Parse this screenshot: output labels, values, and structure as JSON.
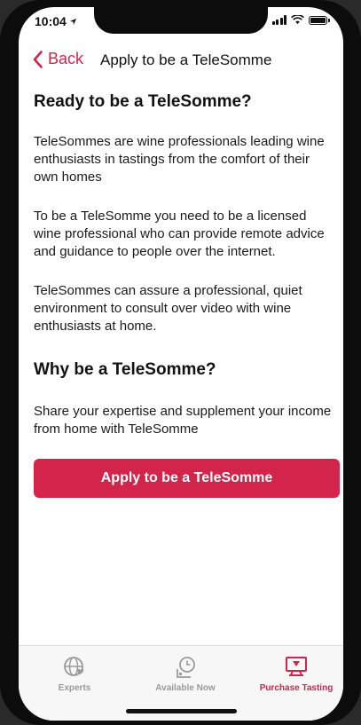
{
  "status": {
    "time": "10:04"
  },
  "nav": {
    "back_label": "Back",
    "title": "Apply to be a TeleSomme"
  },
  "content": {
    "heading1": "Ready to be a TeleSomme?",
    "para1": "TeleSommes are wine professionals leading wine enthusiasts in tastings from the comfort of their own homes",
    "para2": "To be a TeleSomme you need to be a licensed wine professional who can provide remote advice and guidance to people over the internet.",
    "para3": "TeleSommes can assure a professional, quiet environment to consult over video with wine enthusiasts at home.",
    "heading2": "Why be a TeleSomme?",
    "para4": "Share your expertise and supplement your income from home with TeleSomme"
  },
  "apply_button": {
    "label": "Apply to be a TeleSomme"
  },
  "tabs": [
    {
      "label": "Experts",
      "icon": "globe-heart-icon",
      "active": false
    },
    {
      "label": "Available Now",
      "icon": "clock-icon",
      "active": false
    },
    {
      "label": "Purchase Tasting",
      "icon": "video-screen-icon",
      "active": true
    }
  ],
  "colors": {
    "accent": "#d3244b",
    "inactive": "#9a9a9a",
    "text": "#111111"
  }
}
